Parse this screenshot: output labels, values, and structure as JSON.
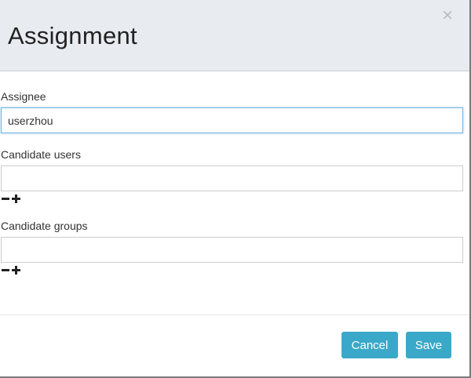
{
  "dialog": {
    "title": "Assignment",
    "close_symbol": "×"
  },
  "assignee": {
    "label": "Assignee",
    "value": "userzhou"
  },
  "candidate_users": {
    "label": "Candidate users",
    "value": ""
  },
  "candidate_groups": {
    "label": "Candidate groups",
    "value": ""
  },
  "icons": {
    "remove": "minus-icon",
    "add": "plus-icon",
    "close": "close-icon"
  },
  "footer": {
    "cancel_label": "Cancel",
    "save_label": "Save"
  },
  "colors": {
    "header_bg": "#e8ebf0",
    "button_bg": "#3aa9c9",
    "focus_border": "#6eb6e0"
  }
}
